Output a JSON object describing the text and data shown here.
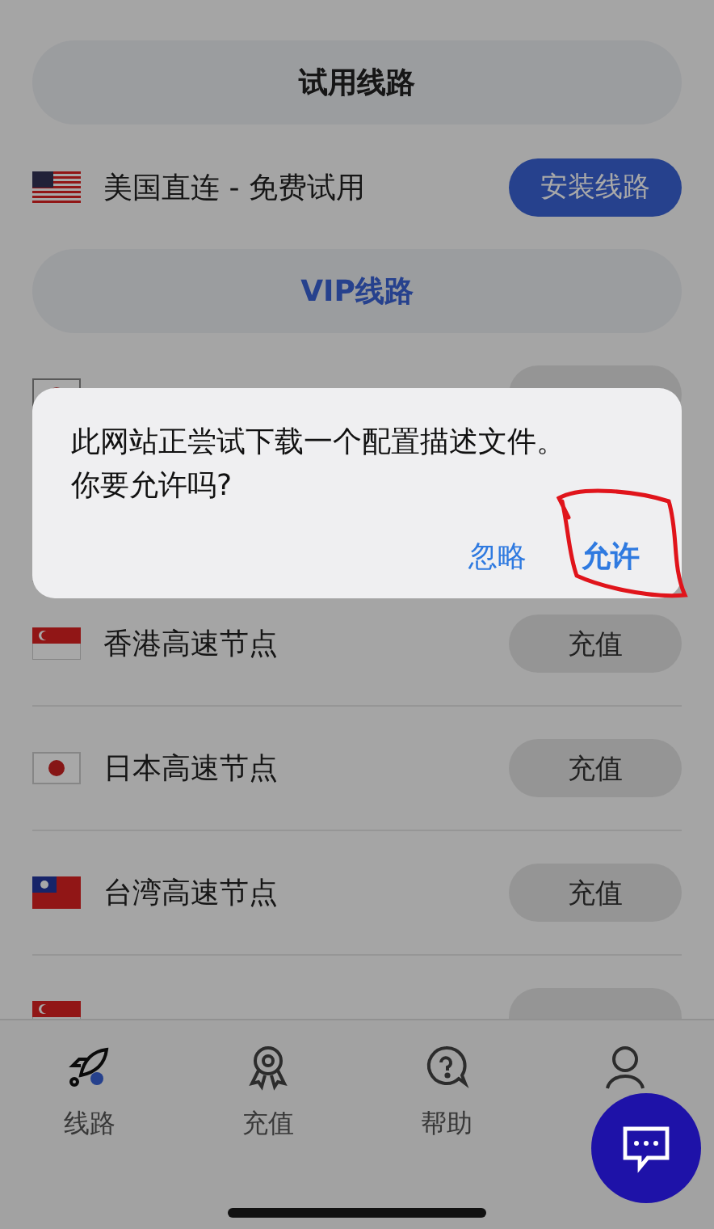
{
  "trial_header": {
    "label": "试用线路"
  },
  "trial_route": {
    "name": "美国直连 - 免费试用",
    "button": "安装线路"
  },
  "vip_header": {
    "label": "VIP线路"
  },
  "vip_routes": [
    {
      "kind": "partial"
    },
    {
      "kind": "hidden"
    },
    {
      "kind": "node",
      "name": "香港高速节点",
      "button": "充值"
    },
    {
      "kind": "node",
      "name": "日本高速节点",
      "button": "充值"
    },
    {
      "kind": "node",
      "name": "台湾高速节点",
      "button": "充值"
    },
    {
      "kind": "partial"
    }
  ],
  "tab_bar": [
    {
      "label": "线路",
      "selected": true
    },
    {
      "label": "充值",
      "selected": false
    },
    {
      "label": "帮助",
      "selected": false
    },
    {
      "selected": false
    }
  ],
  "dialog": {
    "message": "此网站正尝试下载一个配置描述文件。你要允许吗?",
    "buttons": [
      {
        "label": "忽略",
        "highlighted": false
      },
      {
        "label": "允许",
        "highlighted": true
      }
    ]
  }
}
